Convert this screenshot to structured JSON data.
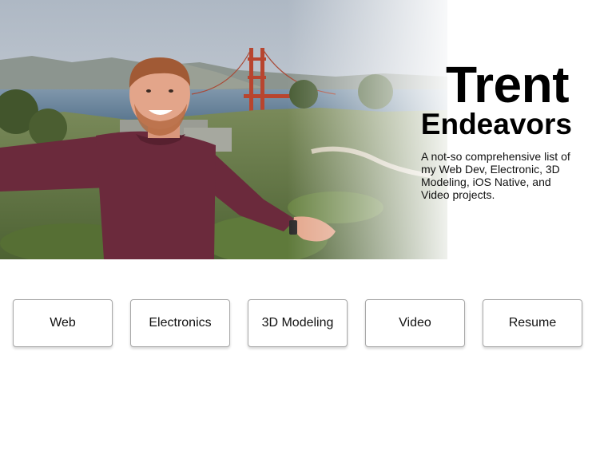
{
  "hero": {
    "title_line1": "Trent",
    "title_line2": "Endeavors",
    "description": "A not-so comprehensive list of my Web Dev, Electronic, 3D Modeling, iOS Native, and Video projects."
  },
  "nav": {
    "buttons": [
      {
        "label": "Web"
      },
      {
        "label": "Electronics"
      },
      {
        "label": "3D Modeling"
      },
      {
        "label": "Video"
      },
      {
        "label": "Resume"
      }
    ]
  },
  "colors": {
    "background": "#ffffff",
    "text": "#000000",
    "button_border": "#a8a8a8",
    "shirt": "#6b2a3c",
    "sky": "#c9d1da",
    "bay": "#6f8aa3",
    "bridge": "#b8452f"
  }
}
